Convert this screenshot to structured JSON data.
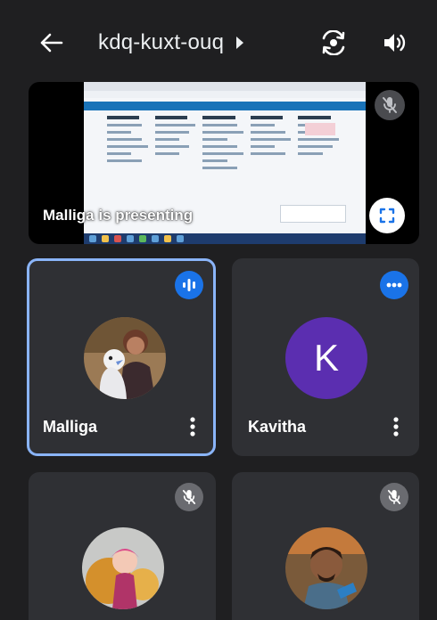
{
  "header": {
    "meeting_code": "kdq-kuxt-ouq",
    "icons": {
      "back": "arrow-left-icon",
      "switch_camera": "switch-camera-icon",
      "speaker": "speaker-icon",
      "details": "caret-right-icon"
    }
  },
  "presentation": {
    "label": "Malliga is presenting",
    "icons": {
      "mute": "mic-off-icon",
      "fullscreen": "fullscreen-icon"
    }
  },
  "participants": [
    {
      "name": "Malliga",
      "status_icon": "audio-wave-icon",
      "status_color": "#1a73e8",
      "active": true
    },
    {
      "name": "Kavitha",
      "avatar_letter": "K",
      "avatar_color": "#5b2eb0",
      "status_icon": "dots-icon",
      "status_color": "#1a73e8"
    },
    {
      "name": "",
      "status_icon": "mic-off-icon"
    },
    {
      "name": "",
      "status_icon": "mic-off-icon"
    }
  ],
  "colors": {
    "background": "#1f1f21",
    "tile": "#2f3034",
    "accent": "#8ab4f8",
    "badge_blue": "#1a73e8"
  }
}
